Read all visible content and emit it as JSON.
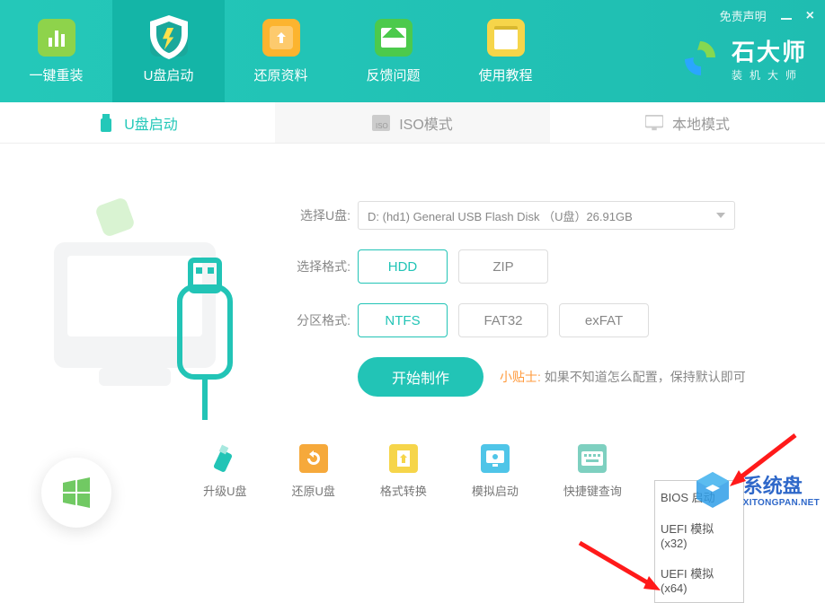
{
  "header": {
    "nav": [
      {
        "label": "一键重装",
        "icon": "bars-icon"
      },
      {
        "label": "U盘启动",
        "icon": "shield-icon"
      },
      {
        "label": "还原资料",
        "icon": "restore-icon"
      },
      {
        "label": "反馈问题",
        "icon": "feedback-icon"
      },
      {
        "label": "使用教程",
        "icon": "tutorial-icon"
      }
    ],
    "brand_title": "石大师",
    "brand_sub": "装机大师",
    "disclaimer": "免责声明"
  },
  "subtabs": {
    "usb": "U盘启动",
    "iso": "ISO模式",
    "local": "本地模式"
  },
  "form": {
    "select_usb_label": "选择U盘:",
    "select_usb_value": "D: (hd1) General USB Flash Disk （U盘）26.91GB",
    "format_label": "选择格式:",
    "format_options": [
      "HDD",
      "ZIP"
    ],
    "format_selected": "HDD",
    "partition_label": "分区格式:",
    "partition_options": [
      "NTFS",
      "FAT32",
      "exFAT"
    ],
    "partition_selected": "NTFS",
    "start_label": "开始制作",
    "tip_label": "小贴士:",
    "tip_text": "如果不知道怎么配置，保持默认即可"
  },
  "boot_menu": {
    "items": [
      "BIOS 启动",
      "UEFI 模拟(x32)",
      "UEFI 模拟(x64)"
    ]
  },
  "tools": {
    "items": [
      {
        "label": "升级U盘",
        "icon": "upgrade-usb-icon",
        "color": "#22c4b6"
      },
      {
        "label": "还原U盘",
        "icon": "restore-usb-icon",
        "color": "#f6a93b"
      },
      {
        "label": "格式转换",
        "icon": "format-convert-icon",
        "color": "#f6d54a"
      },
      {
        "label": "模拟启动",
        "icon": "simulate-boot-icon",
        "color": "#4fc5e8"
      },
      {
        "label": "快捷键查询",
        "icon": "hotkey-icon",
        "color": "#7ed0c0"
      }
    ]
  },
  "watermark": {
    "cn": "系统盘",
    "en": "XITONGPAN.NET"
  },
  "colors": {
    "primary": "#22c4b6",
    "accent_orange": "#ff9a3c"
  }
}
